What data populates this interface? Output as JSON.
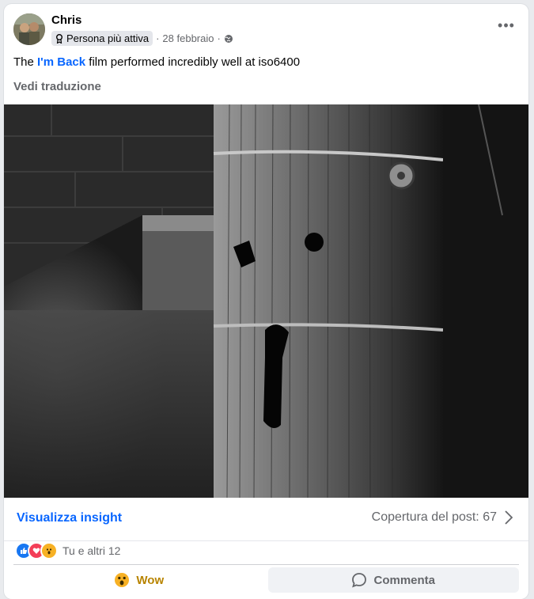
{
  "post": {
    "author": "Chris",
    "badge_label": "Persona più attiva",
    "date": "28 febbraio",
    "separator": "·",
    "privacy_icon": "globe-icon",
    "more_icon": "more-horizontal-icon",
    "text_before": "The ",
    "text_link": "I'm Back",
    "text_after": " film performed incredibly well at iso6400",
    "translate_label": "Vedi traduzione"
  },
  "insights": {
    "link_label": "Visualizza insight",
    "reach_label": "Copertura del post: 67",
    "chevron_icon": "chevron-right-icon"
  },
  "reactions": {
    "icons": [
      "like-icon",
      "love-icon",
      "wow-icon"
    ],
    "summary": "Tu e altri 12"
  },
  "actions": {
    "wow_label": "Wow",
    "comment_label": "Commenta"
  },
  "colors": {
    "link": "#0866ff",
    "like": "#1877f2",
    "love": "#f33e58",
    "wow": "#f7b125"
  }
}
